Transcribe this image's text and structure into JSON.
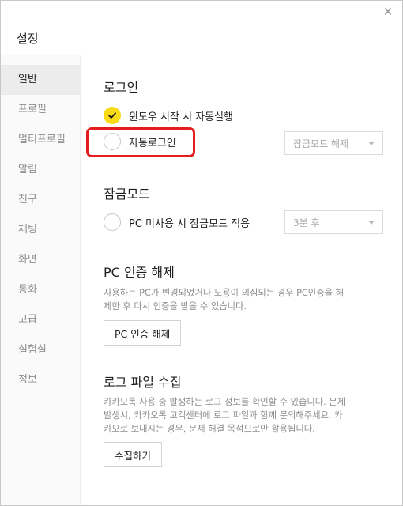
{
  "window": {
    "title": "설정"
  },
  "sidebar": {
    "items": [
      {
        "label": "일반",
        "active": true
      },
      {
        "label": "프로필"
      },
      {
        "label": "멀티프로필"
      },
      {
        "label": "알림"
      },
      {
        "label": "친구"
      },
      {
        "label": "채팅"
      },
      {
        "label": "화면"
      },
      {
        "label": "통화"
      },
      {
        "label": "고급"
      },
      {
        "label": "실험실"
      },
      {
        "label": "정보"
      }
    ]
  },
  "login": {
    "title": "로그인",
    "autostart_label": "윈도우 시작 시 자동실행",
    "autostart_checked": true,
    "autologin_label": "자동로그인",
    "autologin_checked": false,
    "lock_release_select": "잠금모드 해제"
  },
  "lockmode": {
    "title": "잠금모드",
    "idle_label": "PC 미사용 시 잠금모드 적용",
    "idle_checked": false,
    "idle_select": "3분 후"
  },
  "pc_auth": {
    "title": "PC 인증 해제",
    "desc_line1": "사용하는 PC가 변경되었거나 도용이 의심되는 경우 PC인증을 해",
    "desc_line2": "제한 후 다시 인증을 받을 수 있습니다.",
    "button": "PC 인증 해제"
  },
  "log": {
    "title": "로그 파일 수집",
    "desc_line1": "카카오톡 사용 중 발생하는 로그 정보를 확인할 수 있습니다. 문제",
    "desc_line2": " 발생시, 카카오톡 고객센터에 로그 파일과 함께 문의해주세요. 카",
    "desc_line3": "카오로 보내시는 경우, 문제 해결 목적으로만 활용됩니다.",
    "button": "수집하기"
  },
  "colors": {
    "accent": "#f9dc16",
    "highlight": "#e41e1e"
  },
  "icons": {
    "close": "close-icon",
    "check": "checkmark-icon",
    "dropdown": "chevron-down-icon"
  }
}
